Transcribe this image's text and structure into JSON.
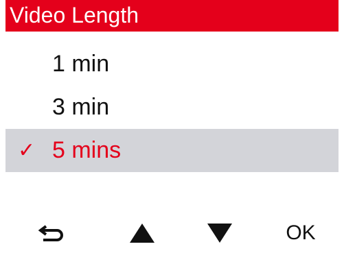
{
  "screen": {
    "title": "Video Length",
    "accent_color": "#e4001b",
    "selected_bg": "#d3d4d9"
  },
  "menu": {
    "items": [
      {
        "label": "1 min",
        "selected": false
      },
      {
        "label": "3 min",
        "selected": false
      },
      {
        "label": "5 mins",
        "selected": true
      }
    ],
    "check_mark": "✓"
  },
  "softkeys": {
    "back_icon": "return-arrow-icon",
    "up_icon": "up-triangle-icon",
    "down_icon": "down-triangle-icon",
    "ok_label": "OK"
  }
}
